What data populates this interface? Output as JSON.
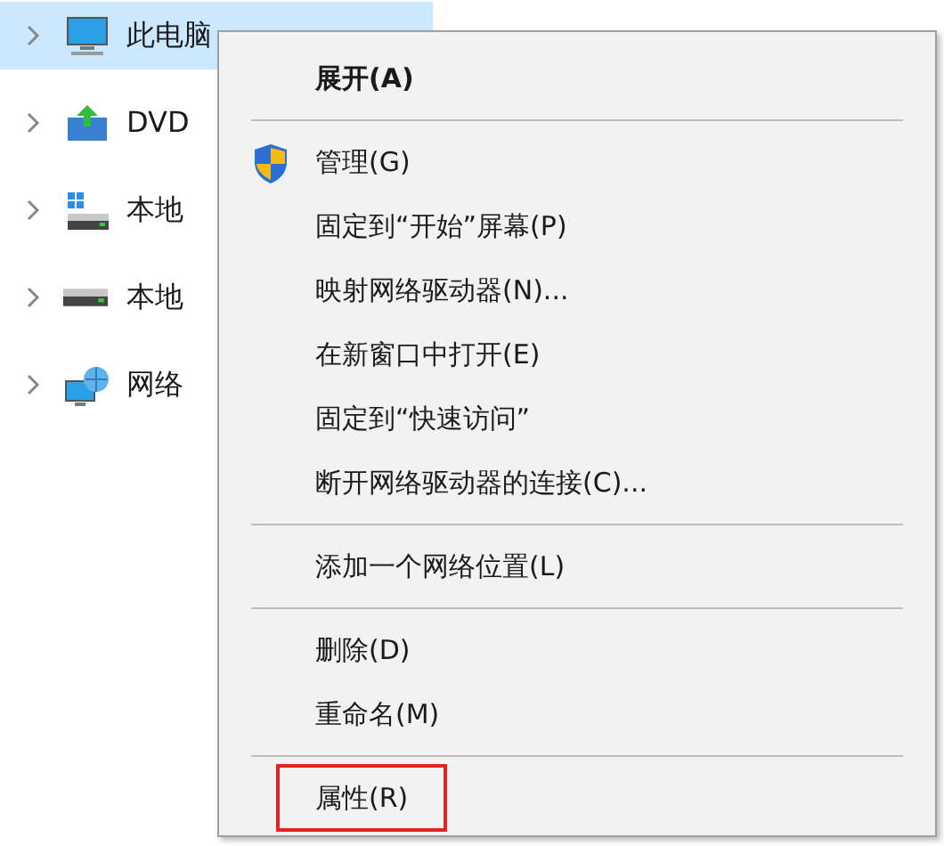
{
  "tree": {
    "items": [
      {
        "label": "此电脑",
        "selected": true
      },
      {
        "label": "DVD",
        "selected": false
      },
      {
        "label": "本地",
        "selected": false
      },
      {
        "label": "本地",
        "selected": false
      },
      {
        "label": "网络",
        "selected": false
      }
    ]
  },
  "context_menu": {
    "items": [
      {
        "kind": "item",
        "label": "展开(A)",
        "default": true,
        "shield_icon": false,
        "outlined": false
      },
      {
        "kind": "separator"
      },
      {
        "kind": "item",
        "label": "管理(G)",
        "default": false,
        "shield_icon": true,
        "outlined": false
      },
      {
        "kind": "item",
        "label": "固定到“开始”屏幕(P)",
        "default": false,
        "shield_icon": false,
        "outlined": false
      },
      {
        "kind": "item",
        "label": "映射网络驱动器(N)...",
        "default": false,
        "shield_icon": false,
        "outlined": false
      },
      {
        "kind": "item",
        "label": "在新窗口中打开(E)",
        "default": false,
        "shield_icon": false,
        "outlined": false
      },
      {
        "kind": "item",
        "label": "固定到“快速访问”",
        "default": false,
        "shield_icon": false,
        "outlined": false
      },
      {
        "kind": "item",
        "label": "断开网络驱动器的连接(C)...",
        "default": false,
        "shield_icon": false,
        "outlined": false
      },
      {
        "kind": "separator"
      },
      {
        "kind": "item",
        "label": "添加一个网络位置(L)",
        "default": false,
        "shield_icon": false,
        "outlined": false
      },
      {
        "kind": "separator"
      },
      {
        "kind": "item",
        "label": "删除(D)",
        "default": false,
        "shield_icon": false,
        "outlined": false
      },
      {
        "kind": "item",
        "label": "重命名(M)",
        "default": false,
        "shield_icon": false,
        "outlined": false
      },
      {
        "kind": "separator"
      },
      {
        "kind": "item",
        "label": "属性(R)",
        "default": false,
        "shield_icon": false,
        "outlined": true
      }
    ]
  }
}
